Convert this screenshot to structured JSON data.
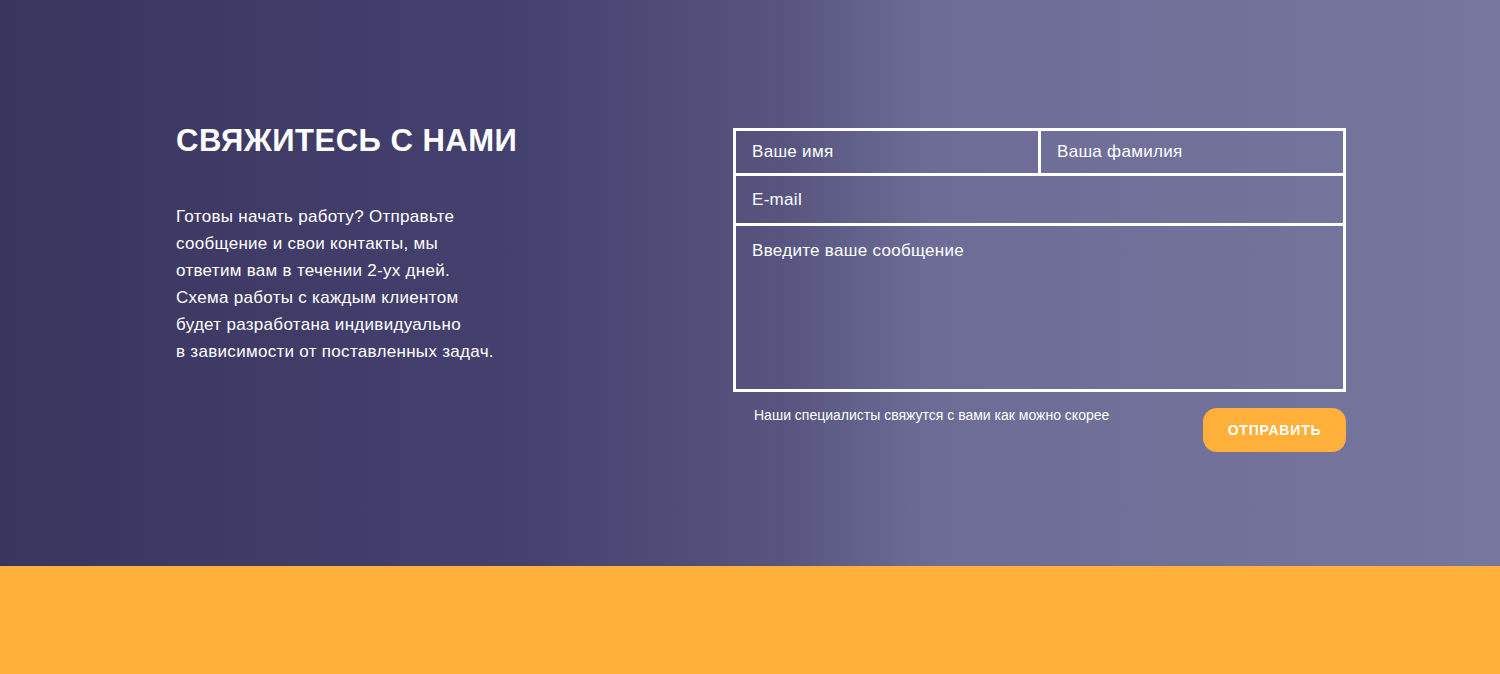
{
  "heading": "СВЯЖИТЕСЬ С НАМИ",
  "description_lines": [
    "Готовы начать работу? Отправьте",
    "сообщение и свои контакты, мы",
    "ответим вам в течении 2-ух дней.",
    "Схема работы с каждым клиентом",
    "будет разработана индивидуально",
    "в зависимости от поставленных задач."
  ],
  "form": {
    "name_fields": [
      {
        "placeholder": "Ваше имя"
      },
      {
        "placeholder": "Ваша фамилия"
      }
    ],
    "email": {
      "placeholder": "E-mail"
    },
    "message": {
      "placeholder": "Введите ваше сообщение"
    },
    "note": "Наши специалисты свяжутся с вами как можно скорее",
    "submit": "ОТПРАВИТЬ"
  }
}
